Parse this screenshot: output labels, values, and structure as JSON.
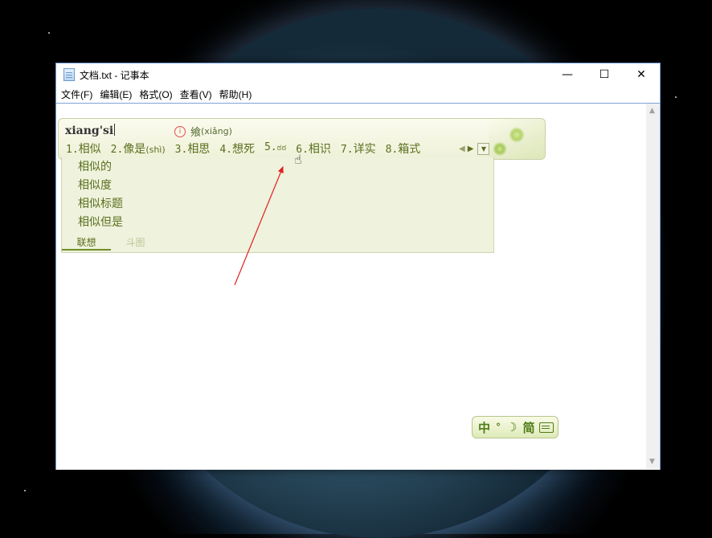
{
  "window": {
    "title": "文档.txt - 记事本",
    "controls": {
      "minimize": "—",
      "maximize": "☐",
      "close": "✕"
    }
  },
  "menu": [
    "文件(F)",
    "编辑(E)",
    "格式(O)",
    "查看(V)",
    "帮助(H)"
  ],
  "ime": {
    "pinyin": "xiang'si",
    "hint_char": "飨",
    "hint_pinyin": "(xiǎng)",
    "candidates": [
      {
        "num": "1.",
        "text": "相似",
        "py": ""
      },
      {
        "num": "2.",
        "text": "像是",
        "py": "(shì)"
      },
      {
        "num": "3.",
        "text": "相思",
        "py": ""
      },
      {
        "num": "4.",
        "text": "想死",
        "py": ""
      },
      {
        "num": "5.",
        "text": "ಠಠ",
        "py": ""
      },
      {
        "num": "6.",
        "text": "相识",
        "py": ""
      },
      {
        "num": "7.",
        "text": "详实",
        "py": ""
      },
      {
        "num": "8.",
        "text": "箱式",
        "py": ""
      }
    ],
    "associations": [
      "相似的",
      "相似度",
      "相似标题",
      "相似但是"
    ],
    "tabs": [
      "联想",
      "斗图"
    ],
    "active_tab": "联想"
  },
  "ime_status": {
    "mode": "中",
    "punct": "°",
    "width": "☽",
    "script": "简"
  },
  "colors": {
    "ime_text": "#5a6f1f",
    "window_border": "#6d9bd3",
    "annotation_arrow": "#e02020"
  }
}
